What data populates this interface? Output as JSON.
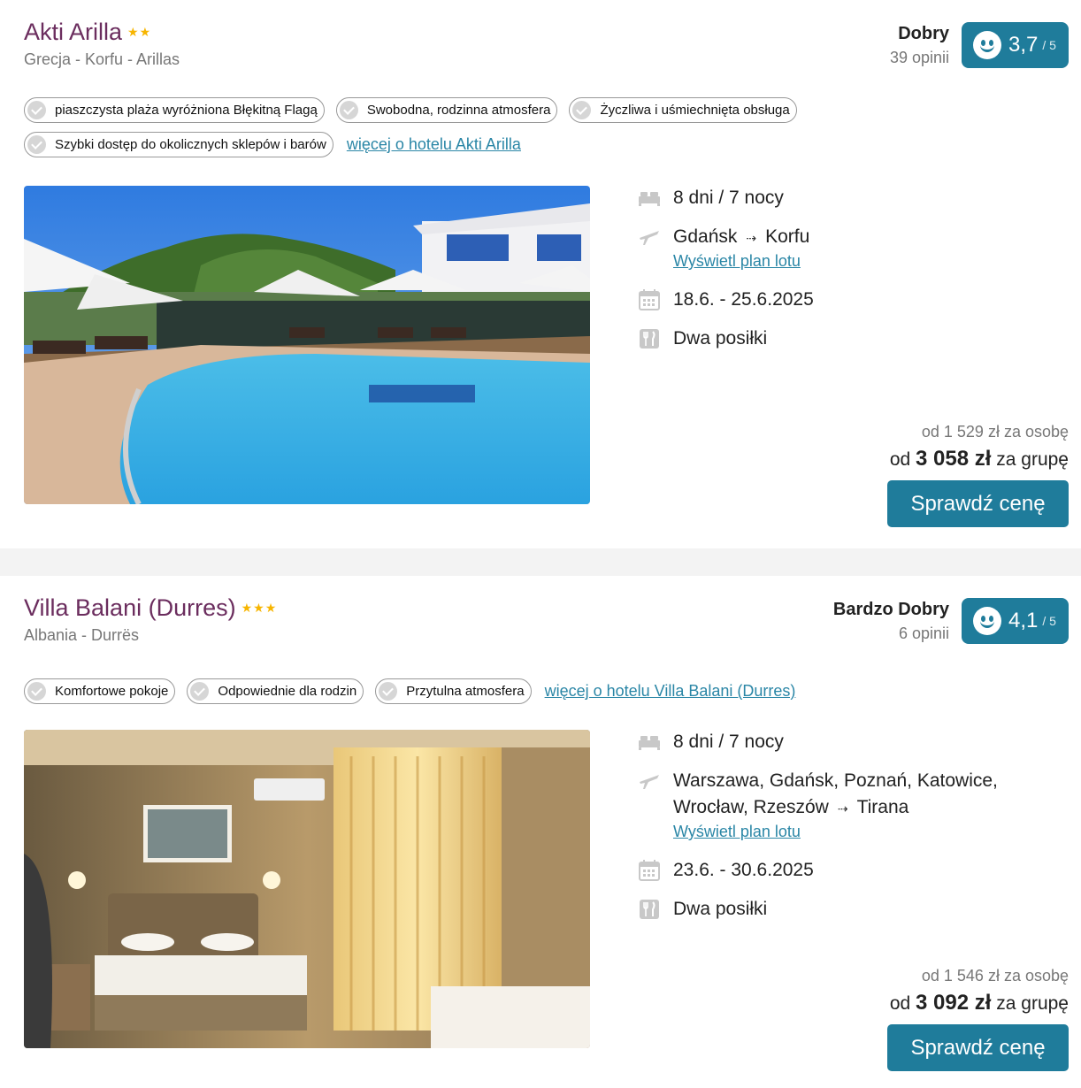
{
  "offers": [
    {
      "name": "Akti Arilla",
      "stars": "★★",
      "location": "Grecja - Korfu - Arillas",
      "rating_label": "Dobry",
      "review_count": "39 opinii",
      "score": "3,7",
      "score_max": "/ 5",
      "tags": [
        "piaszczysta plaża wyróżniona Błękitną Flagą",
        "Swobodna, rodzinna atmosfera",
        "Życzliwa i uśmiechnięta obsługa",
        "Szybki dostęp do okolicznych sklepów i barów"
      ],
      "more_link": "więcej o hotelu Akti Arilla",
      "duration": "8 dni / 7 nocy",
      "departure": "Gdańsk",
      "arrow": "⇢",
      "destination": "Korfu",
      "flight_plan_link": "Wyświetl plan lotu",
      "dates": "18.6. - 25.6.2025",
      "board": "Dwa posiłki",
      "price_per_person": "od 1 529 zł za osobę",
      "price_prefix": "od",
      "price_group": "3 058 zł",
      "price_suffix": "za grupę",
      "cta": "Sprawdź cenę"
    },
    {
      "name": "Villa Balani (Durres)",
      "stars": "★★★",
      "location": "Albania - Durrës",
      "rating_label": "Bardzo Dobry",
      "review_count": "6 opinii",
      "score": "4,1",
      "score_max": "/ 5",
      "tags": [
        "Komfortowe pokoje",
        "Odpowiednie dla rodzin",
        "Przytulna atmosfera"
      ],
      "more_link": "więcej o hotelu Villa Balani (Durres)",
      "duration": "8 dni / 7 nocy",
      "departure_line1": "Warszawa, Gdańsk, Poznań, Katowice,",
      "departure_line2": "Wrocław, Rzeszów",
      "arrow": "⇢",
      "destination": "Tirana",
      "flight_plan_link": "Wyświetl plan lotu",
      "dates": "23.6. - 30.6.2025",
      "board": "Dwa posiłki",
      "price_per_person": "od 1 546 zł za osobę",
      "price_prefix": "od",
      "price_group": "3 092 zł",
      "price_suffix": "za grupę",
      "cta": "Sprawdź cenę"
    }
  ],
  "colors": {
    "accent": "#1f7c9b",
    "title": "#6b2d5e",
    "link": "#2a86a6",
    "stars": "#f7b500"
  },
  "icons": [
    "bed-icon",
    "plane-icon",
    "calendar-icon",
    "cutlery-icon",
    "smiley-icon",
    "check-icon"
  ]
}
